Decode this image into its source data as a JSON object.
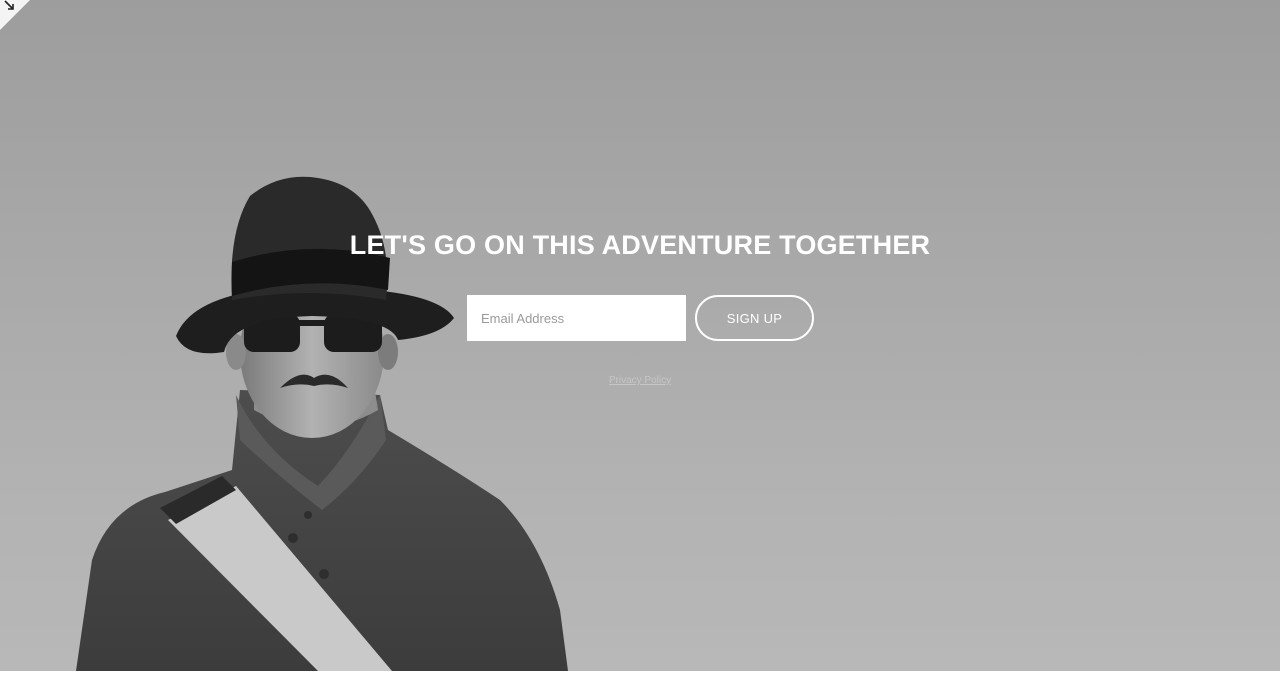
{
  "hero": {
    "headline": "LET'S GO ON THIS ADVENTURE TOGETHER",
    "background_image": "man-in-fedora-and-sunglasses-photo"
  },
  "signup": {
    "email_placeholder": "Email Address",
    "email_value": "",
    "button_label": "SIGN UP"
  },
  "footer": {
    "privacy_label": "Privacy Policy"
  },
  "icons": {
    "corner_toggle": "resize-arrow-icon"
  },
  "colors": {
    "text_primary": "#ffffff",
    "input_background": "#ffffff",
    "placeholder": "#9a9a9a"
  }
}
